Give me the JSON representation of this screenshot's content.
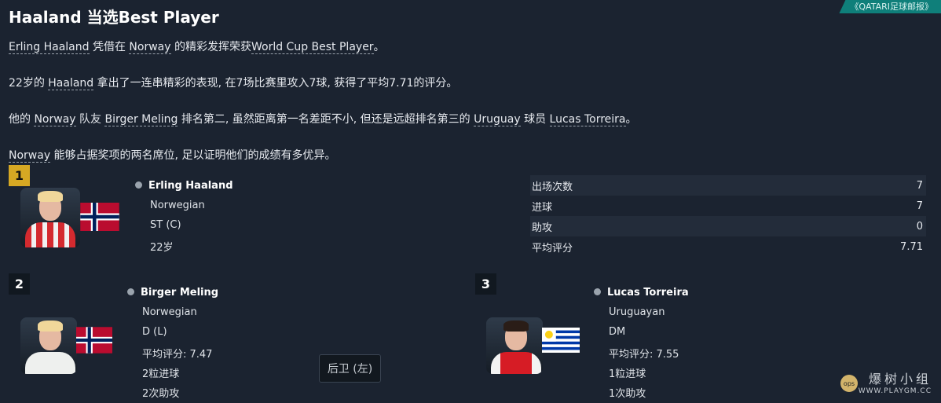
{
  "header": {
    "title": "Haaland 当选Best Player",
    "source": "《QATARI足球邮报》"
  },
  "article": {
    "p1": {
      "name": "Erling Haaland",
      "mid": " 凭借在 ",
      "team": "Norway",
      "rest": " 的精彩发挥荣获",
      "award": "World Cup Best Player",
      "end": "。"
    },
    "p2": {
      "pre": "22岁的 ",
      "name": "Haaland",
      "rest": " 拿出了一连串精彩的表现, 在7场比赛里攻入7球, 获得了平均7.71的评分。"
    },
    "p3": {
      "pre": "他的 ",
      "team": "Norway",
      "mid": " 队友 ",
      "name": "Birger Meling",
      "mid2": " 排名第二, 虽然距离第一名差距不小, 但还是远超排名第三的 ",
      "team2": "Uruguay",
      "mid3": " 球员 ",
      "name2": "Lucas Torreira",
      "end": "。"
    },
    "p4": {
      "team": "Norway",
      "rest": " 能够占据奖项的两名席位, 足以证明他们的成绩有多优异。"
    }
  },
  "winner": {
    "rank": "1",
    "name": "Erling Haaland",
    "nationality": "Norwegian",
    "position": "ST (C)",
    "age": "22岁",
    "flag": "norway-flag",
    "stats": [
      {
        "label": "出场次数",
        "value": "7"
      },
      {
        "label": "进球",
        "value": "7"
      },
      {
        "label": "助攻",
        "value": "0"
      },
      {
        "label": "平均评分",
        "value": "7.71"
      }
    ]
  },
  "second": {
    "rank": "2",
    "name": "Birger Meling",
    "nationality": "Norwegian",
    "position": "D (L)",
    "rating": "平均评分: 7.47",
    "goals": "2粒进球",
    "assists": "2次助攻",
    "flag": "norway-flag"
  },
  "third": {
    "rank": "3",
    "name": "Lucas Torreira",
    "nationality": "Uruguayan",
    "position": "DM",
    "rating": "平均评分: 7.55",
    "goals": "1粒进球",
    "assists": "1次助攻",
    "flag": "uruguay-flag"
  },
  "tooltip": "后卫 (左)",
  "watermark": {
    "cn": "爆树小组",
    "url": "WWW.PLAYGM.CC",
    "logo": "ops"
  },
  "colors": {
    "accent": "#0f7f7a",
    "rank_gold": "#d6a823",
    "background": "#1b2330"
  }
}
